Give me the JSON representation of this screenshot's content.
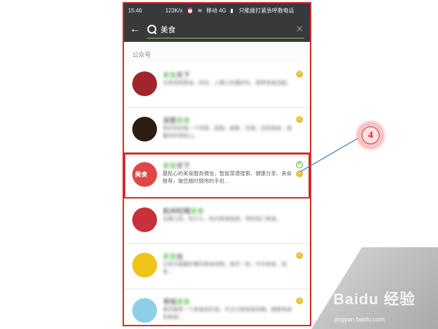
{
  "status_bar": {
    "time": "15:46",
    "speed": "123K/s",
    "carrier": "移动 4G",
    "notice": "只能拨打紧急呼救电话"
  },
  "search": {
    "value": "美食",
    "back_icon": "arrow-left-icon",
    "search_icon": "magnifier-icon",
    "clear_icon": "close-icon"
  },
  "section": {
    "header": "公众号"
  },
  "results": [
    {
      "title_pre": "",
      "title_hl": "美食",
      "title_post": "天下",
      "desc": "分享各种美食，好吃、上哪儿吃最好吃，推荐美食话题。",
      "avatar_color": "#a0262b",
      "verified": true,
      "registered": false
    },
    {
      "title_pre": "深夜",
      "title_hl": "美食",
      "title_post": "",
      "desc": "陪伴你的每一个深夜，孤独、疲惫、彷徨，还有美食，温暖你的胃和心。",
      "avatar_color": "#2b1d12",
      "verified": true,
      "registered": false
    },
    {
      "title_pre": "",
      "title_hl": "美食",
      "title_post": "天下",
      "desc": "最贴心的美食服务微信，智能菜谱搜索、健康分享、美食推荐，做您随时随地的手机…",
      "avatar_color": "#e04848",
      "avatar_label": "美食",
      "verified": true,
      "registered": true
    },
    {
      "title_pre": "杭州吃喝",
      "title_hl": "美食",
      "title_post": "",
      "desc": "去哪儿吃，吃什么，杭州美食指南，带你找门美食。",
      "avatar_color": "#c8303a",
      "verified": false,
      "registered": false
    },
    {
      "title_pre": "",
      "title_hl": "美食",
      "title_post": "台",
      "desc": "分享中国最好看的美食视频，每天一条；中华美食，泡茶…",
      "avatar_color": "#f0c419",
      "verified": true,
      "registered": false
    },
    {
      "title_pre": "寻找",
      "title_hl": "美食",
      "title_post": "",
      "desc": "每天推荐一个美食目的地，专注讨某美食攻略，搜索地道的美食！",
      "avatar_color": "#8fcfe6",
      "verified": true,
      "registered": false
    }
  ],
  "annotation": {
    "number": "4"
  },
  "watermark": {
    "brand": "Baidu 经验",
    "url": "jingyan.baidu.com"
  },
  "colors": {
    "accent_green": "#45b035",
    "highlight_red": "#d32a2a",
    "bar_dark": "#37393b"
  }
}
